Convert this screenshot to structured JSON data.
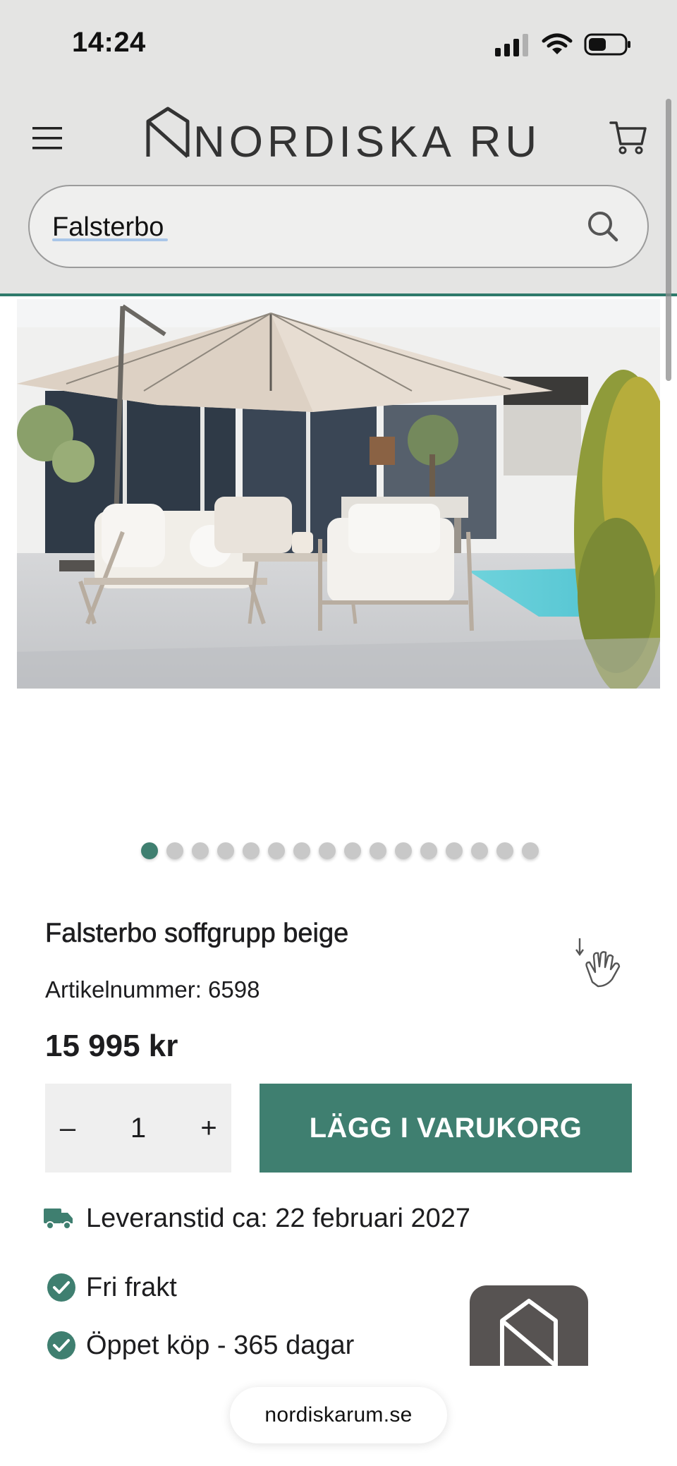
{
  "status_bar": {
    "time": "14:24"
  },
  "header": {
    "logo_text": "NORDISKA RUM",
    "menu_icon": "hamburger-menu-icon",
    "cart_icon": "shopping-cart-icon",
    "accent_color": "#2e7a6b"
  },
  "search": {
    "value": "Falsterbo",
    "icon": "search-icon"
  },
  "gallery": {
    "slide_count": 16,
    "active_index": 0
  },
  "product": {
    "title": "Falsterbo soffgrupp beige",
    "article": "Artikelnummer: 6598",
    "price": "15 995 kr"
  },
  "quantity": {
    "minus": "–",
    "value": "1",
    "plus": "+"
  },
  "add_to_cart": {
    "label": "LÄGG I VARUKORG",
    "color": "#3f7f70"
  },
  "delivery": {
    "text": "Leveranstid ca: 22 februari 2027",
    "icon": "truck-icon"
  },
  "features": [
    {
      "text": "Fri frakt",
      "icon": "check-circle-icon"
    },
    {
      "text": "Öppet köp - 365 dagar",
      "icon": "check-circle-icon"
    }
  ],
  "browser": {
    "url": "nordiskarum.se"
  }
}
